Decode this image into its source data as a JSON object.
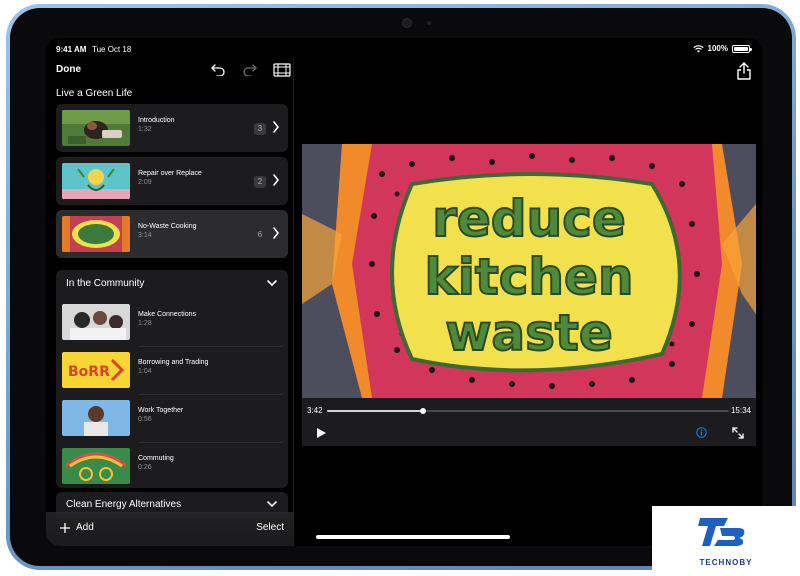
{
  "status_bar": {
    "time": "9:41 AM",
    "date": "Tue Oct 18",
    "battery": "100%"
  },
  "sidebar": {
    "done_label": "Done",
    "project_title": "Live a Green Life",
    "clips": [
      {
        "title": "Introduction",
        "duration": "1:32",
        "count": "3"
      },
      {
        "title": "Repair over Replace",
        "duration": "2:09",
        "count": "2"
      },
      {
        "title": "No-Waste Cooking",
        "duration": "3:14",
        "count": "6"
      }
    ],
    "groups": [
      {
        "header": "In the Community",
        "items": [
          {
            "title": "Make Connections",
            "duration": "1:28"
          },
          {
            "title": "Borrowing and Trading",
            "duration": "1:04"
          },
          {
            "title": "Work Together",
            "duration": "0:56"
          },
          {
            "title": "Commuting",
            "duration": "0:26"
          }
        ]
      },
      {
        "header": "Clean Energy Alternatives"
      }
    ],
    "add_label": "Add",
    "select_label": "Select"
  },
  "viewer": {
    "time_current": "3:42",
    "time_total": "15:34",
    "progress": 0.24,
    "video_lines": [
      "reduce",
      "kitchen",
      "waste"
    ]
  },
  "watermark": {
    "text": "TECHNOBY"
  },
  "colors": {
    "accent": "#0a84ff",
    "card": "#1c1c1e",
    "selected_card": "#2c2c2e"
  }
}
